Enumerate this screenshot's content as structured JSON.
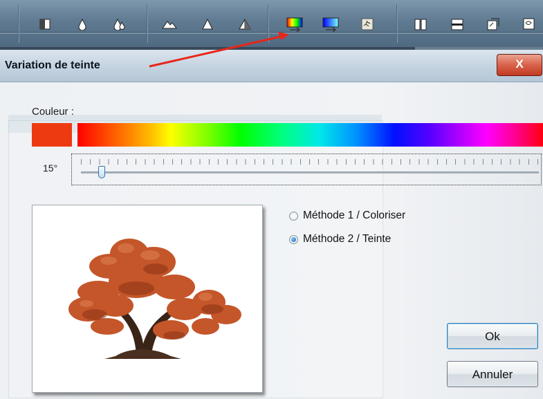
{
  "toolbar": {
    "buttons": [
      {
        "icon": "bw-square-icon"
      },
      {
        "icon": "drop-small-icon"
      },
      {
        "icon": "drops-icon"
      },
      {
        "icon": "landscape-icon"
      },
      {
        "icon": "triangle-icon"
      },
      {
        "icon": "triangle-split-icon"
      },
      {
        "icon": "hue-gradient-icon"
      },
      {
        "icon": "color-gradient-icon"
      },
      {
        "icon": "runner-icon"
      },
      {
        "icon": "columns-icon"
      },
      {
        "icon": "panel-icon"
      },
      {
        "icon": "rotate-icon"
      },
      {
        "icon": "warp-icon"
      }
    ]
  },
  "dialog": {
    "title": "Variation de teinte",
    "close_label": "X",
    "color_label": "Couleur :",
    "color_value": "#ee3a10",
    "hue_value": "15°",
    "hue_fraction": 0.04,
    "methods": [
      {
        "label": "Méthode 1 / Coloriser",
        "checked": false
      },
      {
        "label": "Méthode 2 / Teinte",
        "checked": true
      }
    ],
    "ok_label": "Ok",
    "cancel_label": "Annuler"
  },
  "colors": {
    "accent_red": "#e8261a",
    "swatch": "#ee3a10",
    "tree_foliage": "#c4562a"
  }
}
